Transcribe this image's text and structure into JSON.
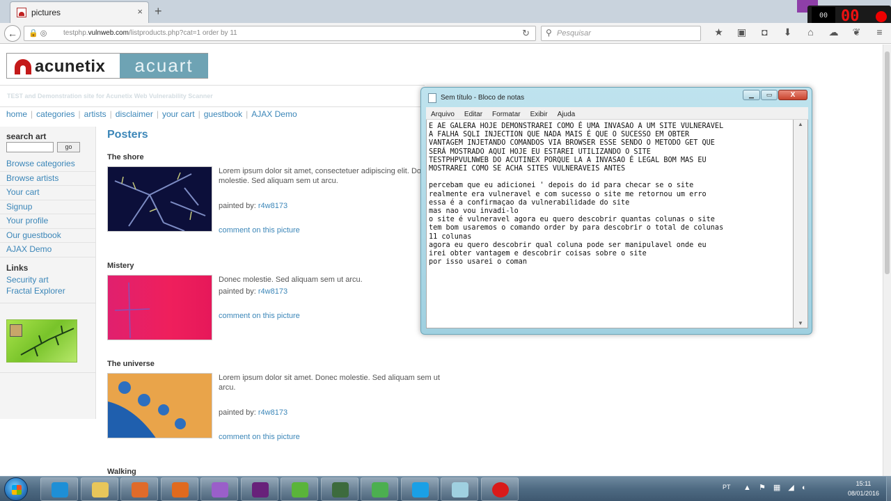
{
  "browser": {
    "tab_title": "pictures",
    "tab_close": "×",
    "new_tab": "+",
    "url_icons": "🔒 ◎",
    "url_domain": "testphp.vulnweb.com",
    "url_path": "/listproducts.php?cat=1 order by 11",
    "url_prefix": "testphp.",
    "reload_glyph": "↻",
    "search_placeholder": "Pesquisar",
    "toolbar_icons": [
      "★",
      "▣",
      "◘",
      "⬇",
      "⌂",
      "☁",
      "❦",
      "≡"
    ]
  },
  "recorder": {
    "small_clock": "00",
    "big_digits": "00"
  },
  "site": {
    "logo_acunetix": "acunetix",
    "logo_acuart": "acuart",
    "tagline": "TEST and Demonstration site for Acunetix Web Vulnerability Scanner",
    "topnav": [
      "home",
      "categories",
      "artists",
      "disclaimer",
      "your cart",
      "guestbook",
      "AJAX Demo"
    ],
    "search_title": "search art",
    "search_button": "go",
    "side_links": [
      "Browse categories",
      "Browse artists",
      "Your cart",
      "Signup",
      "Your profile",
      "Our guestbook",
      "AJAX Demo"
    ],
    "links_title": "Links",
    "ext_links": [
      "Security art",
      "Fractal Explorer"
    ],
    "page_title": "Posters",
    "products": [
      {
        "title": "The shore",
        "desc": "Lorem ipsum dolor sit amet, consectetuer adipiscing elit. Donec molestie. Sed aliquam sem ut arcu.",
        "painted_prefix": "painted by: ",
        "artist": "r4w8173",
        "comment": "comment on this picture"
      },
      {
        "title": "Mistery",
        "desc": "Donec molestie. Sed aliquam sem ut arcu.",
        "painted_prefix": "painted by: ",
        "artist": "r4w8173",
        "comment": "comment on this picture"
      },
      {
        "title": "The universe",
        "desc": "Lorem ipsum dolor sit amet. Donec molestie. Sed aliquam sem ut arcu.",
        "painted_prefix": "painted by: ",
        "artist": "r4w8173",
        "comment": "comment on this picture"
      },
      {
        "title": "Walking"
      }
    ]
  },
  "notepad": {
    "title": "Sem título - Bloco de notas",
    "menu": [
      "Arquivo",
      "Editar",
      "Formatar",
      "Exibir",
      "Ajuda"
    ],
    "min_glyph": "▁",
    "max_glyph": "▭",
    "close_glyph": "X",
    "text": "E AE GALERA HOJE DEMONSTRAREI COMO É UMA INVASAO A UM SITE VULNERAVEL\nA FALHA SQLI INJECTION QUE NADA MAIS É QUE O SUCESSO EM OBTER\nVANTAGEM INJETANDO COMANDOS VIA BROWSER ESSE SENDO O METODO GET QUE\nSERÁ MOSTRADO AQUI HOJE EU ESTAREI UTILIZANDO O SITE\nTESTPHPVULNWEB DO ACUTINEX PORQUE LA A INVASAO É LEGAL BOM MAS EU\nMOSTRAREI COMO SE ACHA SITES VULNERAVEIS ANTES\n\npercebam que eu adicionei ' depois do id para checar se o site\nrealmente era vulneravel e com sucesso o site me retornou um erro\nessa é a confirmaçao da vulnerabilidade do site\nmas nao vou invadi-lo\no site é vulneravel agora eu quero descobrir quantas colunas o site\ntem bom usaremos o comando order by para descobrir o total de colunas\n11 colunas\nagora eu quero descobrir qual coluna pode ser manipulavel onde eu\nirei obter vantagem e descobrir coisas sobre o site\npor isso usarei o coman"
  },
  "taskbar": {
    "apps": [
      {
        "name": "ie",
        "color": "#1e8fd6"
      },
      {
        "name": "explorer",
        "color": "#e8c65a"
      },
      {
        "name": "media",
        "color": "#e06b2a"
      },
      {
        "name": "firefox",
        "color": "#e06a1e"
      },
      {
        "name": "camtasia",
        "color": "#9a5fc9"
      },
      {
        "name": "visual-studio",
        "color": "#68217a"
      },
      {
        "name": "utorrent",
        "color": "#5ab43a"
      },
      {
        "name": "terminal",
        "color": "#3d6b3d"
      },
      {
        "name": "recycle",
        "color": "#4caf50"
      },
      {
        "name": "skype",
        "color": "#1aa0e6"
      },
      {
        "name": "notepad",
        "color": "#9fd0e0"
      },
      {
        "name": "record",
        "color": "#d91a1a"
      }
    ],
    "lang": "PT",
    "tray_icons": "▲ ⚑ ▦ ◢ ◐",
    "time": "15:11",
    "date": "08/01/2016"
  }
}
